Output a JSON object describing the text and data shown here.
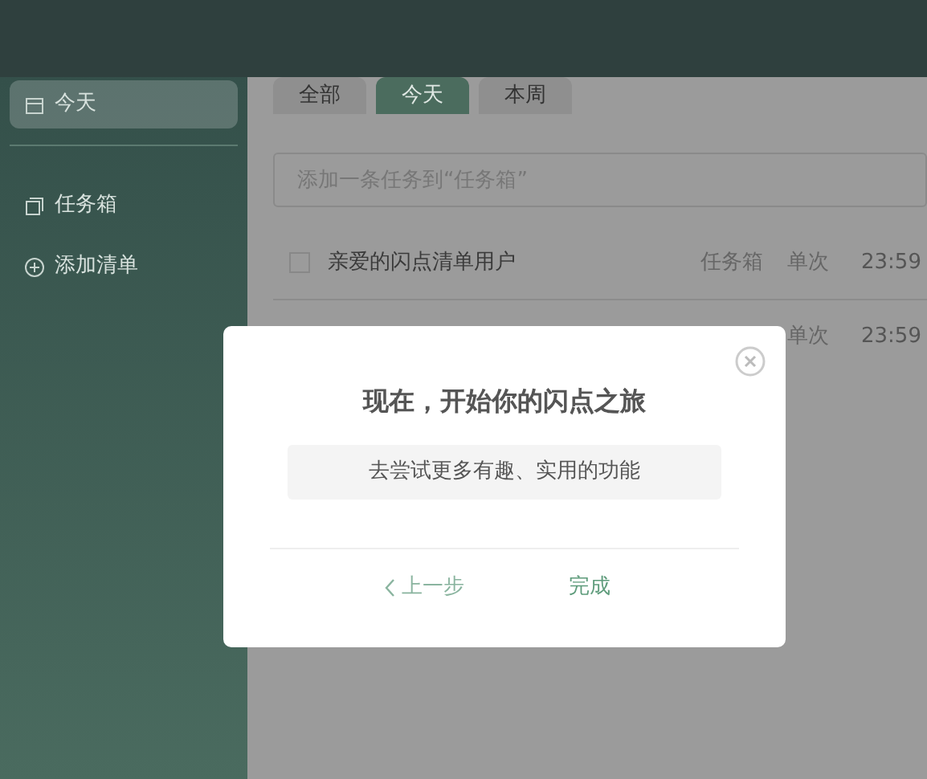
{
  "sidebar": {
    "items": [
      {
        "label": "今天",
        "selected": true
      },
      {
        "label": "任务箱",
        "selected": false
      },
      {
        "label": "添加清单",
        "selected": false
      }
    ]
  },
  "tabs": [
    {
      "label": "全部",
      "selected": false
    },
    {
      "label": "今天",
      "selected": true
    },
    {
      "label": "本周",
      "selected": false
    }
  ],
  "task_input": {
    "placeholder": "添加一条任务到“任务箱”"
  },
  "tasks": [
    {
      "title": "亲爱的闪点清单用户",
      "list": "任务箱",
      "repeat": "单次",
      "time": "23:59",
      "checked": false
    },
    {
      "repeat": "单次",
      "time": "23:59"
    }
  ],
  "dialog": {
    "title": "现在，开始你的闪点之旅",
    "message": "去尝试更多有趣、实用的功能",
    "back": "上一步",
    "done": "完成"
  }
}
